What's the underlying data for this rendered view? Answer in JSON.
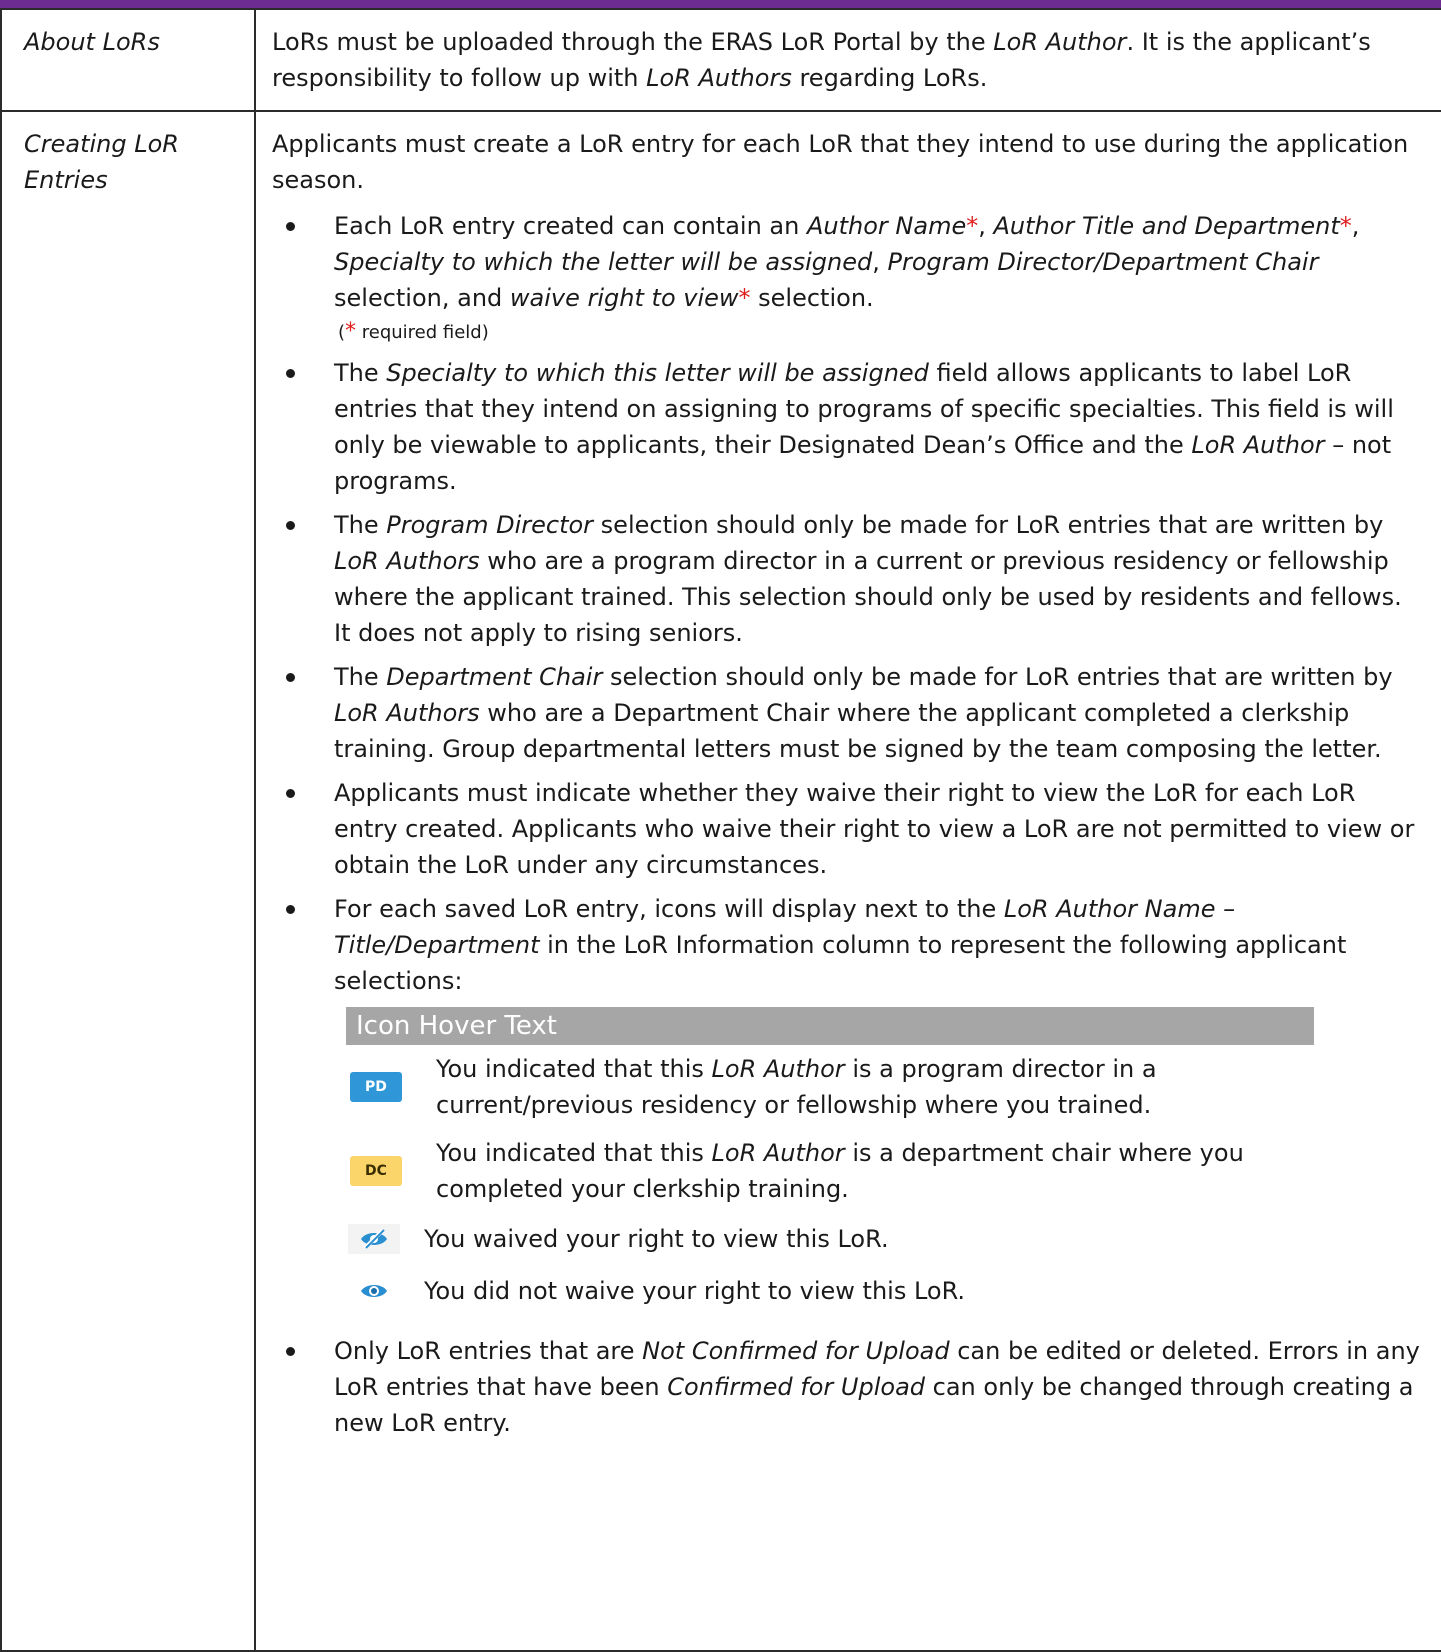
{
  "rows": {
    "about": {
      "label": "About LoRs",
      "text_a": "LoRs must be uploaded through the ERAS LoR Portal by the ",
      "em_a": "LoR Author",
      "text_b": ". It is the applicant’s responsibility to follow up with ",
      "em_b": "LoR Authors",
      "text_c": " regarding LoRs."
    },
    "creating": {
      "label": "Creating LoR Entries",
      "intro": "Applicants must create a LoR entry for each LoR that they intend to use during the application season.",
      "b1": {
        "t1": "Each LoR entry created can contain an ",
        "e1": "Author Name",
        "star": "*",
        "t2": ", ",
        "e2": "Author Title and Department",
        "t3": ", ",
        "e3": "Specialty to which the letter will be assigned",
        "t4": ", ",
        "e4": "Program Director/Department Chair",
        "t5": " selection, and ",
        "e5": "waive right to view",
        "t6": " selection.",
        "note_open": "(",
        "note_text": " required field)"
      },
      "b2": {
        "t1": "The ",
        "e1": "Specialty to which this letter will be assigned",
        "t2": " field allows applicants to label LoR entries that they intend on assigning to programs of specific specialties. This field is will only be viewable to applicants, their Designated Dean’s Office and the ",
        "e2": "LoR Author",
        "t3": " – not programs."
      },
      "b3": {
        "t1": "The ",
        "e1": "Program Director",
        "t2": " selection should only be made for LoR entries that are written by ",
        "e2": "LoR Authors",
        "t3": " who are a program director in a current or previous residency or fellowship where the applicant trained. This selection should only be used by residents and fellows. It does not apply to rising seniors."
      },
      "b4": {
        "t1": "The ",
        "e1": "Department Chair",
        "t2": " selection should only be made for LoR entries that are written by ",
        "e2": "LoR Authors",
        "t3": " who are a Department Chair where the applicant completed a clerkship training. Group departmental letters must be signed by the team composing the letter."
      },
      "b5": "Applicants must indicate whether they waive their right to view the LoR for each LoR entry created. Applicants who waive their right to view a LoR are not permitted to view or obtain the LoR under any circumstances.",
      "b6": {
        "t1": "For each saved LoR entry, icons will display next to the ",
        "e1": "LoR Author Name – Title/Department",
        "t2": " in the LoR Information column to represent the following applicant selections:"
      },
      "icon_table": {
        "header": "Icon Hover Text",
        "pd": {
          "badge": "PD",
          "t1": "You indicated that this ",
          "e1": "LoR Author",
          "t2": " is a program director in a current/previous residency or fellowship where you trained."
        },
        "dc": {
          "badge": "DC",
          "t1": "You indicated that this ",
          "e1": "LoR Author",
          "t2": " is a department chair where you completed your clerkship training."
        },
        "waived": "You waived your right to view this LoR.",
        "not_waived": "You did not waive your right to view this LoR."
      },
      "b7": {
        "t1": "Only LoR entries that are ",
        "e1": "Not Confirmed for Upload",
        "t2": " can be edited or deleted. Errors in any LoR entries that have been ",
        "e2": "Confirmed for Upload",
        "t3": " can only be changed through creating a new LoR entry."
      }
    }
  },
  "colors": {
    "top_bar": "#6d2c91",
    "required_star": "#e01e1e",
    "pd_badge": "#2f97d8",
    "dc_badge": "#fbd56a",
    "icon_header": "#a6a6a6",
    "eye_icon": "#2a8fd0"
  }
}
